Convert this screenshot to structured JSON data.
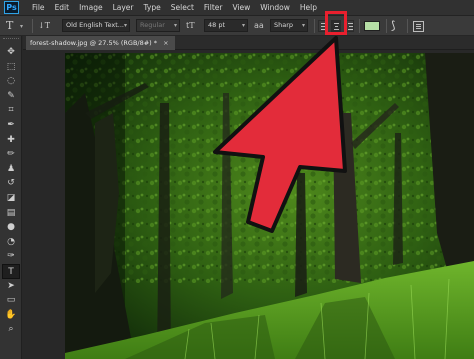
{
  "app": {
    "logo_text": "Ps"
  },
  "menu": [
    "File",
    "Edit",
    "Image",
    "Layer",
    "Type",
    "Select",
    "Filter",
    "View",
    "Window",
    "Help"
  ],
  "options_bar": {
    "tool_glyph": "T",
    "orientation_glyph": "↓T",
    "font_family": "Old English Text...",
    "font_style": "Regular",
    "size_glyph": "tT",
    "font_size": "48 pt",
    "aa_glyph": "aa",
    "antialias": "Sharp",
    "text_color": "#b6dfa6",
    "warp_glyph": "⟆"
  },
  "document_tab": {
    "title": "forest-shadow.jpg @ 27.5% (RGB/8#) *",
    "close": "×"
  },
  "tools": [
    {
      "name": "move-tool",
      "glyph": "✥"
    },
    {
      "name": "marquee-tool",
      "glyph": "⬚"
    },
    {
      "name": "lasso-tool",
      "glyph": "◌"
    },
    {
      "name": "quick-select-tool",
      "glyph": "✎"
    },
    {
      "name": "crop-tool",
      "glyph": "⌗"
    },
    {
      "name": "eyedropper-tool",
      "glyph": "✒"
    },
    {
      "name": "healing-tool",
      "glyph": "✚"
    },
    {
      "name": "brush-tool",
      "glyph": "✏"
    },
    {
      "name": "stamp-tool",
      "glyph": "♟"
    },
    {
      "name": "history-brush-tool",
      "glyph": "↺"
    },
    {
      "name": "eraser-tool",
      "glyph": "◪"
    },
    {
      "name": "gradient-tool",
      "glyph": "▤"
    },
    {
      "name": "blur-tool",
      "glyph": "●"
    },
    {
      "name": "dodge-tool",
      "glyph": "◔"
    },
    {
      "name": "pen-tool",
      "glyph": "✑"
    },
    {
      "name": "type-tool",
      "glyph": "T"
    },
    {
      "name": "path-select-tool",
      "glyph": "➤"
    },
    {
      "name": "shape-tool",
      "glyph": "▭"
    },
    {
      "name": "hand-tool",
      "glyph": "✋"
    },
    {
      "name": "zoom-tool",
      "glyph": "⌕"
    }
  ],
  "colors": {
    "highlight": "#e8202e",
    "arrow": "#e32c3a",
    "arrow_outline": "#111111"
  }
}
